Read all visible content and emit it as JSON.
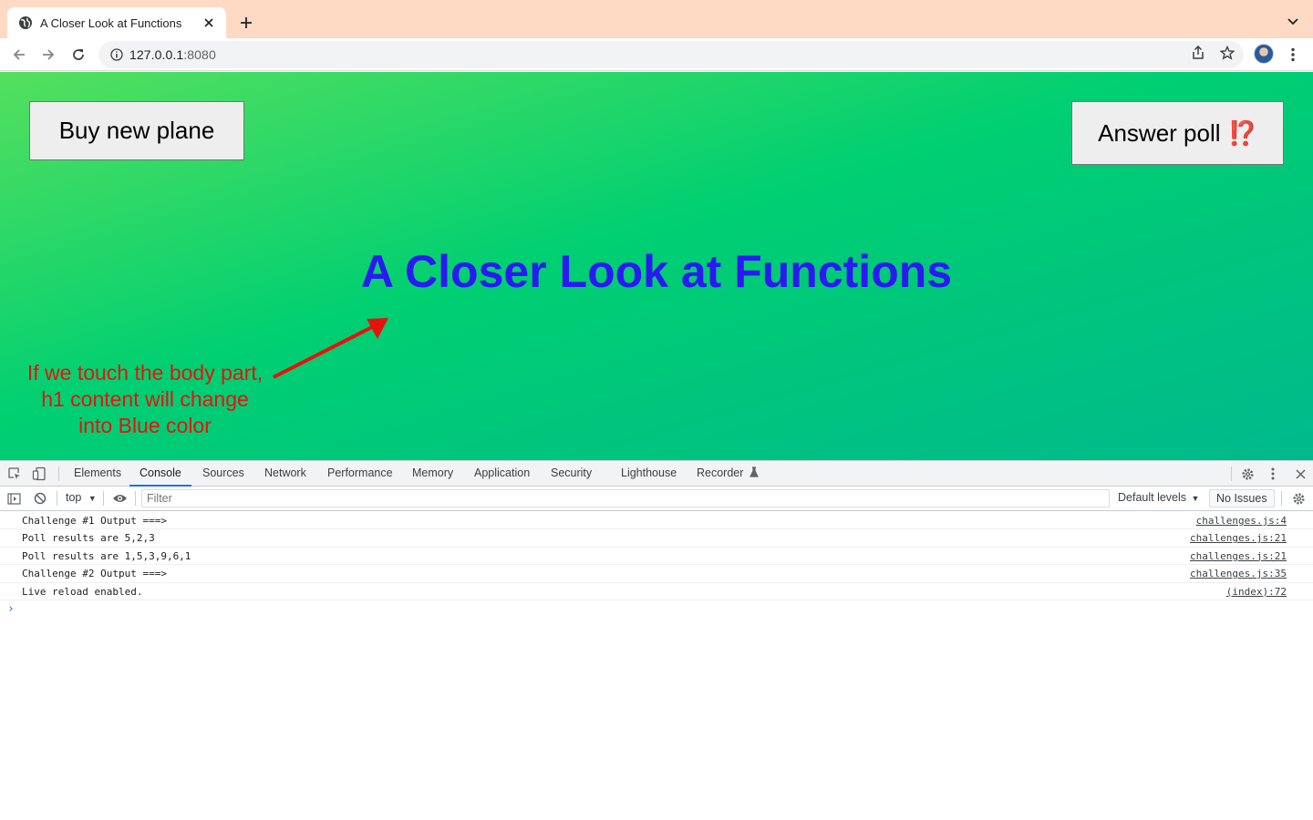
{
  "browser": {
    "tab_title": "A Closer Look at Functions",
    "url_host": "127.0.0.1",
    "url_port": ":8080"
  },
  "page": {
    "buy_button_label": "Buy new plane",
    "poll_button_label": "Answer poll",
    "poll_button_emoji": "⁉️",
    "heading": "A Closer Look at Functions",
    "heading_color": "#2b19f2",
    "annotation_lines": [
      "If we touch the body part,",
      "h1 content will change",
      "into Blue color"
    ],
    "annotation_color": "#e8120d"
  },
  "devtools": {
    "tabs": [
      "Elements",
      "Console",
      "Sources",
      "Network",
      "Performance",
      "Memory",
      "Application",
      "Security",
      "Lighthouse",
      "Recorder"
    ],
    "active_tab": "Console",
    "context": "top",
    "filter_placeholder": "Filter",
    "levels_label": "Default levels",
    "issues_label": "No Issues",
    "logs": [
      {
        "message": "Challenge #1 Output ===>",
        "source": "challenges.js:4"
      },
      {
        "message": "Poll results are 5,2,3",
        "source": "challenges.js:21"
      },
      {
        "message": "Poll results are 1,5,3,9,6,1",
        "source": "challenges.js:21"
      },
      {
        "message": "Challenge #2 Output ===>",
        "source": "challenges.js:35"
      },
      {
        "message": "Live reload enabled.",
        "source": "(index):72"
      }
    ]
  }
}
